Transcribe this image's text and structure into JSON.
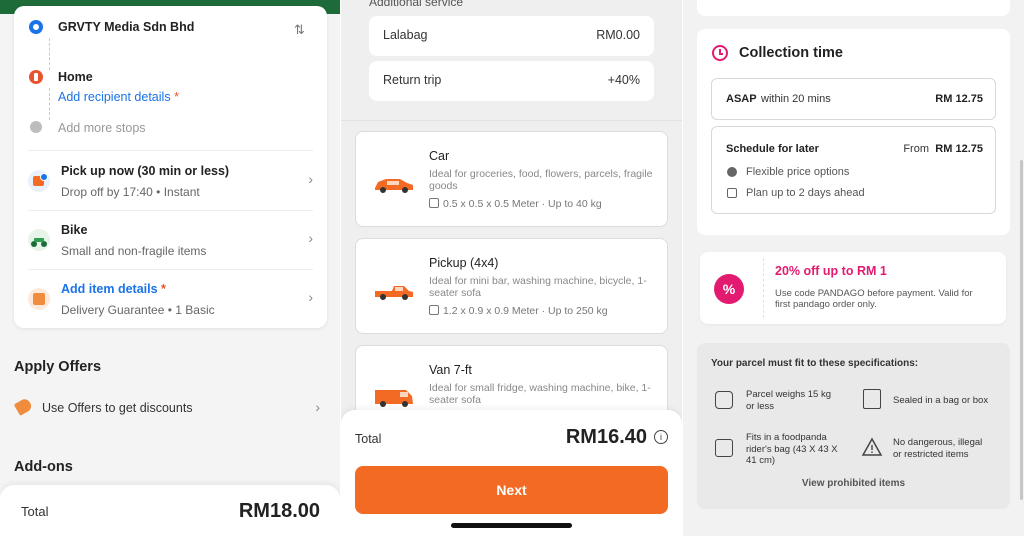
{
  "panel1": {
    "company": "GRVTY Media Sdn Bhd",
    "stop_label": "Home",
    "add_recipient": "Add recipient details",
    "required_mark": "*",
    "add_stops": "Add more stops",
    "pickup_title": "Pick up now (30 min or less)",
    "pickup_sub": "Drop off by 17:40 • Instant",
    "bike_title": "Bike",
    "bike_sub": "Small and non-fragile items",
    "item_title": "Add item details",
    "item_sub": "Delivery Guarantee • 1 Basic",
    "apply_offers": "Apply Offers",
    "use_offers": "Use Offers to get discounts",
    "addons": "Add-ons",
    "total_label": "Total",
    "total_value": "RM18.00",
    "icons": [
      "pin-blue-icon",
      "pin-orange-icon",
      "pin-grey-icon",
      "swap-icon",
      "clock-icon",
      "bike-icon",
      "box-icon",
      "tag-icon",
      "chevron-right-icon"
    ]
  },
  "panel2": {
    "additional_title": "Additional service",
    "services": [
      {
        "name": "Lalabag",
        "price": "RM0.00"
      },
      {
        "name": "Return trip",
        "price": "+40%"
      }
    ],
    "vehicles": [
      {
        "name": "Car",
        "desc": "Ideal for groceries, food, flowers, parcels, fragile goods",
        "spec": "0.5 x 0.5 x 0.5 Meter · Up to 40 kg"
      },
      {
        "name": "Pickup (4x4)",
        "desc": "Ideal for mini bar, washing machine, bicycle, 1-seater sofa",
        "spec": "1.2 x 0.9 x 0.9 Meter · Up to 250 kg"
      },
      {
        "name": "Van 7-ft",
        "desc": "Ideal for small fridge, washing machine, bike, 1-seater sofa",
        "spec": ""
      }
    ],
    "total_label": "Total",
    "total_value": "RM16.40",
    "next_label": "Next",
    "accent": "#f36a24"
  },
  "panel3": {
    "collection_title": "Collection time",
    "asap_bold": "ASAP",
    "asap_rest": "within 20 mins",
    "asap_price": "RM 12.75",
    "schedule_title": "Schedule for later",
    "schedule_from": "From",
    "schedule_price": "RM 12.75",
    "flex_price": "Flexible price options",
    "plan_ahead": "Plan up to 2 days ahead",
    "promo_title": "20% off up to RM 1",
    "promo_desc_1": "Use code PANDAGO before payment. Valid for",
    "promo_desc_2": "first pandago order only.",
    "spec_title": "Your parcel must fit to these specifications:",
    "spec_weight_1": "Parcel weighs 15 kg",
    "spec_weight_2": "or less",
    "spec_sealed": "Sealed in a bag or box",
    "spec_fit_1": "Fits in a foodpanda",
    "spec_fit_2": "rider's bag (43 X 43 X",
    "spec_fit_3": "41 cm)",
    "spec_danger_1": "No dangerous, illegal",
    "spec_danger_2": "or restricted items",
    "view_prohibited": "View prohibited items",
    "accent": "#e21b70"
  }
}
